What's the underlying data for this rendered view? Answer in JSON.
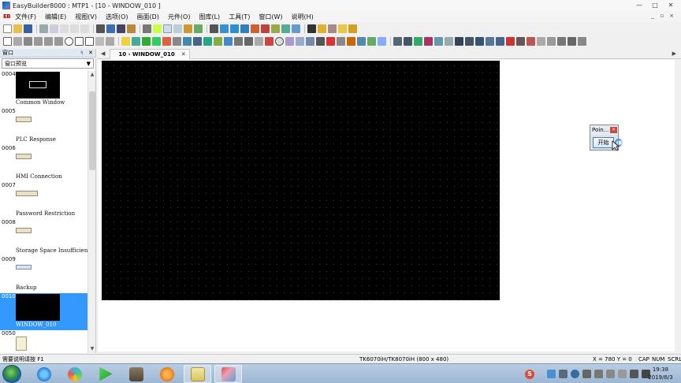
{
  "window": {
    "title": "EasyBuilder8000 : MTP1 - [10 - WINDOW_010 ]",
    "controls": [
      "—",
      "□",
      "✕"
    ]
  },
  "menubar": {
    "logo": "EB",
    "items": [
      "文件(F)",
      "编辑(E)",
      "视图(V)",
      "选项(O)",
      "画面(D)",
      "元件(O)",
      "图库(L)",
      "工具(T)",
      "窗口(W)",
      "说明(H)"
    ],
    "mdi_controls": [
      "_",
      "▫",
      "×"
    ]
  },
  "left_pane": {
    "header_label": "窗口",
    "pin": "ᛋ",
    "close": "✕",
    "combo_value": "窗口预览",
    "combo_arrow": "▼",
    "items": [
      {
        "num": "0004",
        "name": "Common Window"
      },
      {
        "num": "0005",
        "name": "PLC Response"
      },
      {
        "num": "0006",
        "name": "HMI Connection"
      },
      {
        "num": "0007",
        "name": "Password Restriction"
      },
      {
        "num": "0008",
        "name": "Storage Space Insufficient"
      },
      {
        "num": "0009",
        "name": "Backup"
      },
      {
        "num": "0010",
        "name": "WINDOW_010"
      },
      {
        "num": "0050",
        "name": ""
      }
    ],
    "selected_index": 6
  },
  "doc_tabs": {
    "nav_left": "◀",
    "nav_right": "▶",
    "active_tab": "10 - WINDOW_010",
    "tab_close": "✕"
  },
  "point_widget": {
    "title": "Poin...",
    "close": "×",
    "start_label": "开始"
  },
  "statusbar": {
    "help": "需要说明请按 F1",
    "model": "TK6070iH/TK8070iH (800 x 480)",
    "coords": "X = 780   Y = 0",
    "caps": "CAP",
    "num": "NUM",
    "scrl": "SCRL"
  },
  "taskbar": {
    "lang_indicator": "S",
    "time": "19:38",
    "date": "2019/6/3",
    "apps": [
      "browser",
      "pinwheel",
      "media-player",
      "photo-app",
      "orange-app",
      "folder-app",
      "easybuilder"
    ]
  },
  "colors": {
    "accent": "#3399ff",
    "canvas": "#000000",
    "workspace": "#ffffff"
  }
}
